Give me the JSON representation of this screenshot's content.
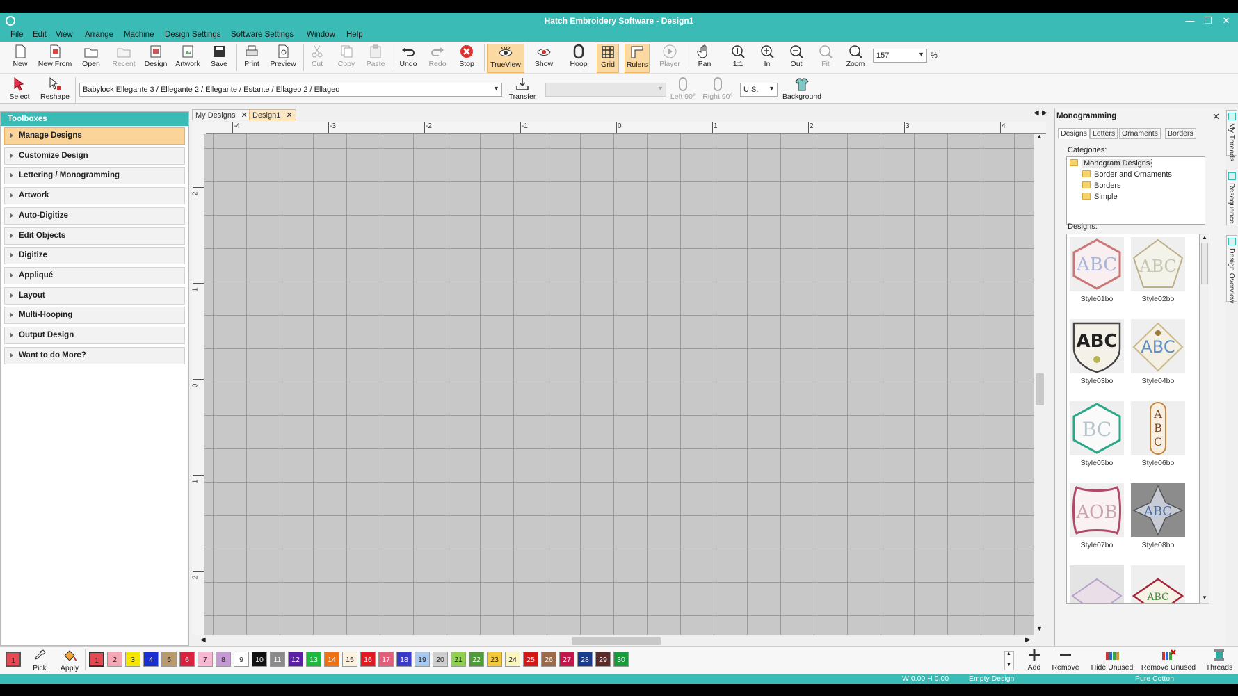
{
  "window": {
    "title": "Hatch Embroidery Software - Design1"
  },
  "menu": [
    "File",
    "Edit",
    "View",
    "Arrange",
    "Machine",
    "Design Settings",
    "Software Settings",
    "Window",
    "Help"
  ],
  "toolbar": {
    "new": "New",
    "new_from": "New From",
    "open": "Open",
    "recent": "Recent",
    "design": "Design",
    "artwork": "Artwork",
    "save": "Save",
    "print": "Print",
    "preview": "Preview",
    "cut": "Cut",
    "copy": "Copy",
    "paste": "Paste",
    "undo": "Undo",
    "redo": "Redo",
    "stop": "Stop",
    "trueview": "TrueView",
    "show": "Show",
    "hoop": "Hoop",
    "grid": "Grid",
    "rulers": "Rulers",
    "player": "Player",
    "pan": "Pan",
    "one_to_one": "1:1",
    "zoom_in": "In",
    "zoom_out": "Out",
    "fit": "Fit",
    "zoom": "Zoom",
    "zoom_value": "157",
    "zoom_unit": "%"
  },
  "toolbar2": {
    "select": "Select",
    "reshape": "Reshape",
    "machine_format": "Babylock Ellegante 3 / Ellegante 2 / Ellegante / Estante / Ellageo 2 / Ellageo",
    "transfer": "Transfer",
    "left90": "Left 90°",
    "right90": "Right 90°",
    "units": "U.S.",
    "background": "Background"
  },
  "toolboxes": {
    "header": "Toolboxes",
    "items": [
      "Manage Designs",
      "Customize Design",
      "Lettering / Monogramming",
      "Artwork",
      "Auto-Digitize",
      "Edit Objects",
      "Digitize",
      "Appliqué",
      "Layout",
      "Multi-Hooping",
      "Output Design",
      "Want to do More?"
    ]
  },
  "tabs": [
    {
      "label": "My Designs"
    },
    {
      "label": "Design1"
    }
  ],
  "rulers": {
    "h": [
      "-4",
      "-3",
      "-2",
      "-1",
      "0",
      "1",
      "2",
      "3",
      "4"
    ],
    "v": [
      "2",
      "1",
      "0",
      "1",
      "2"
    ]
  },
  "monogramming": {
    "title": "Monogramming",
    "tabs": [
      "Designs",
      "Letters",
      "Ornaments",
      "Borders"
    ],
    "categories_label": "Categories:",
    "categories": [
      "Monogram Designs",
      "Border and Ornaments",
      "Borders",
      "Simple"
    ],
    "designs_label": "Designs:",
    "designs": [
      "Style01bo",
      "Style02bo",
      "Style03bo",
      "Style04bo",
      "Style05bo",
      "Style06bo",
      "Style07bo",
      "Style08bo"
    ]
  },
  "side_tabs": [
    "My Threads",
    "Resequence",
    "Design Overview"
  ],
  "bottom": {
    "pick": "Pick",
    "apply": "Apply",
    "current_color": "1",
    "colors": [
      {
        "n": "1",
        "c": "#e44a52"
      },
      {
        "n": "2",
        "c": "#f4a7b4"
      },
      {
        "n": "3",
        "c": "#f5e600"
      },
      {
        "n": "4",
        "c": "#1a2fd0"
      },
      {
        "n": "5",
        "c": "#b89a6e"
      },
      {
        "n": "6",
        "c": "#d8223f"
      },
      {
        "n": "7",
        "c": "#f6b8d2"
      },
      {
        "n": "8",
        "c": "#c59ad3"
      },
      {
        "n": "9",
        "c": "#ffffff"
      },
      {
        "n": "10",
        "c": "#111111"
      },
      {
        "n": "11",
        "c": "#8a8a8a"
      },
      {
        "n": "12",
        "c": "#5b1fa6"
      },
      {
        "n": "13",
        "c": "#1db83e"
      },
      {
        "n": "14",
        "c": "#f07014"
      },
      {
        "n": "15",
        "c": "#fbf3df"
      },
      {
        "n": "16",
        "c": "#e01b24"
      },
      {
        "n": "17",
        "c": "#e0607c"
      },
      {
        "n": "18",
        "c": "#3a3ac8"
      },
      {
        "n": "19",
        "c": "#a8c8ee"
      },
      {
        "n": "20",
        "c": "#cfcfcf"
      },
      {
        "n": "21",
        "c": "#8fd14f"
      },
      {
        "n": "22",
        "c": "#4f9a3a"
      },
      {
        "n": "23",
        "c": "#f2c73a"
      },
      {
        "n": "24",
        "c": "#fbf5c0"
      },
      {
        "n": "25",
        "c": "#d41818"
      },
      {
        "n": "26",
        "c": "#9a6a4a"
      },
      {
        "n": "27",
        "c": "#c2174a"
      },
      {
        "n": "28",
        "c": "#1a3a8a"
      },
      {
        "n": "29",
        "c": "#5a2a2a"
      },
      {
        "n": "30",
        "c": "#1a9a3a"
      }
    ],
    "add": "Add",
    "remove": "Remove",
    "hide_unused": "Hide Unused",
    "remove_unused": "Remove Unused",
    "threads": "Threads"
  },
  "status": {
    "dimensions": "W 0.00 H 0.00",
    "state": "Empty Design",
    "fabric": "Pure Cotton"
  },
  "accent_color": "#3bbbb5"
}
